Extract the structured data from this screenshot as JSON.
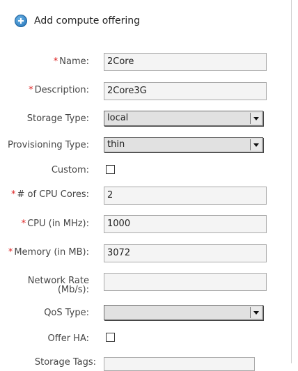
{
  "dialog": {
    "title": "Add compute offering"
  },
  "form": {
    "name": {
      "label": "Name:",
      "required": "*",
      "value": "2Core"
    },
    "description": {
      "label": "Description:",
      "required": "*",
      "value": "2Core3G"
    },
    "storage_type": {
      "label": "Storage Type:",
      "value": "local"
    },
    "provisioning_type": {
      "label": "Provisioning Type:",
      "value": "thin"
    },
    "custom": {
      "label": "Custom:",
      "checked": false
    },
    "cpu_cores": {
      "label": "# of CPU Cores:",
      "required": "*",
      "value": "2"
    },
    "cpu_mhz": {
      "label": "CPU (in MHz):",
      "required": "*",
      "value": "1000"
    },
    "memory_mb": {
      "label": "Memory (in MB):",
      "required": "*",
      "value": "3072"
    },
    "network_rate": {
      "label_line1": "Network Rate",
      "label_line2": "(Mb/s):",
      "value": ""
    },
    "qos_type": {
      "label": "QoS Type:",
      "value": ""
    },
    "offer_ha": {
      "label": "Offer HA:",
      "checked": false
    },
    "storage_tags": {
      "label": "Storage Tags:"
    }
  },
  "icons": {
    "header": "plus-circle-icon",
    "select_arrow": "chevron-down-icon"
  },
  "colors": {
    "required_marker": "#dd2222",
    "header_icon": "#1f6fb5"
  }
}
